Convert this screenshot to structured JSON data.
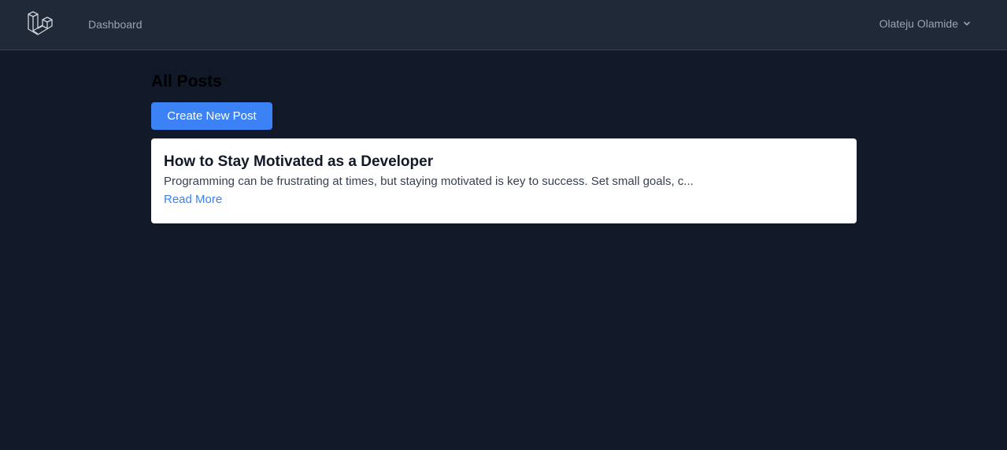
{
  "header": {
    "logo_icon": "laravel-logo-icon",
    "nav_dashboard": "Dashboard",
    "user_name": "Olateju Olamide",
    "user_menu_icon": "chevron-down-icon"
  },
  "main": {
    "title": "All Posts",
    "create_button_label": "Create New Post",
    "posts": [
      {
        "title": "How to Stay Motivated as a Developer",
        "excerpt": "Programming can be frustrating at times, but staying motivated is key to success. Set small goals, c...",
        "read_more_label": "Read More"
      }
    ]
  },
  "colors": {
    "background": "#111827",
    "navbar": "#1f2937",
    "accent": "#3b82f6",
    "card": "#ffffff"
  }
}
